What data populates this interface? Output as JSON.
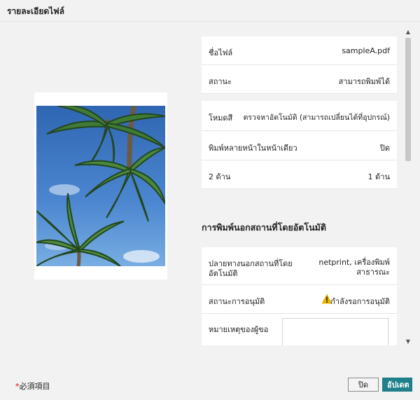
{
  "window": {
    "title": "รายละเอียดไฟล์"
  },
  "file_info": [
    {
      "label": "ชื่อไฟล์",
      "value": "sampleA.pdf"
    },
    {
      "label": "สถานะ",
      "value": "สามารถพิมพ์ได้"
    }
  ],
  "print_settings": [
    {
      "label": "โหมดสี",
      "value": "ตรวจหาอัตโนมัติ (สามารถเปลี่ยนได้ที่อุปกรณ์)"
    },
    {
      "label": "พิมพ์หลายหน้าในหน้าเดียว",
      "value": "ปิด"
    },
    {
      "label": "2 ด้าน",
      "value": "1 ด้าน"
    }
  ],
  "auto_offsite": {
    "title": "การพิมพ์นอกสถานที่โดยอัตโนมัติ",
    "destination_label_line1": "ปลายทางนอกสถานที่โดย",
    "destination_label_line2": "อัตโนมัติ",
    "destination_value_line1": "netprint, เครื่องพิมพ์",
    "destination_value_line2": "สาธารณะ",
    "approval_label": "สถานะการอนุมัติ",
    "approval_value": "กำลังรอการอนุมัติ",
    "memo_label": "หมายเหตุของผู้ขอ",
    "memo_value": ""
  },
  "footer": {
    "required_star": "*",
    "required_text": "必須項目",
    "close_label": "ปิด",
    "update_label": "อัปเดต"
  },
  "icons": {
    "warning": "warning-triangle-icon",
    "scroll_up": "chevron-up-icon",
    "scroll_down": "chevron-down-icon"
  },
  "colors": {
    "accent": "#1f7f8a",
    "warning": "#e8b100",
    "required": "#cc0000"
  }
}
